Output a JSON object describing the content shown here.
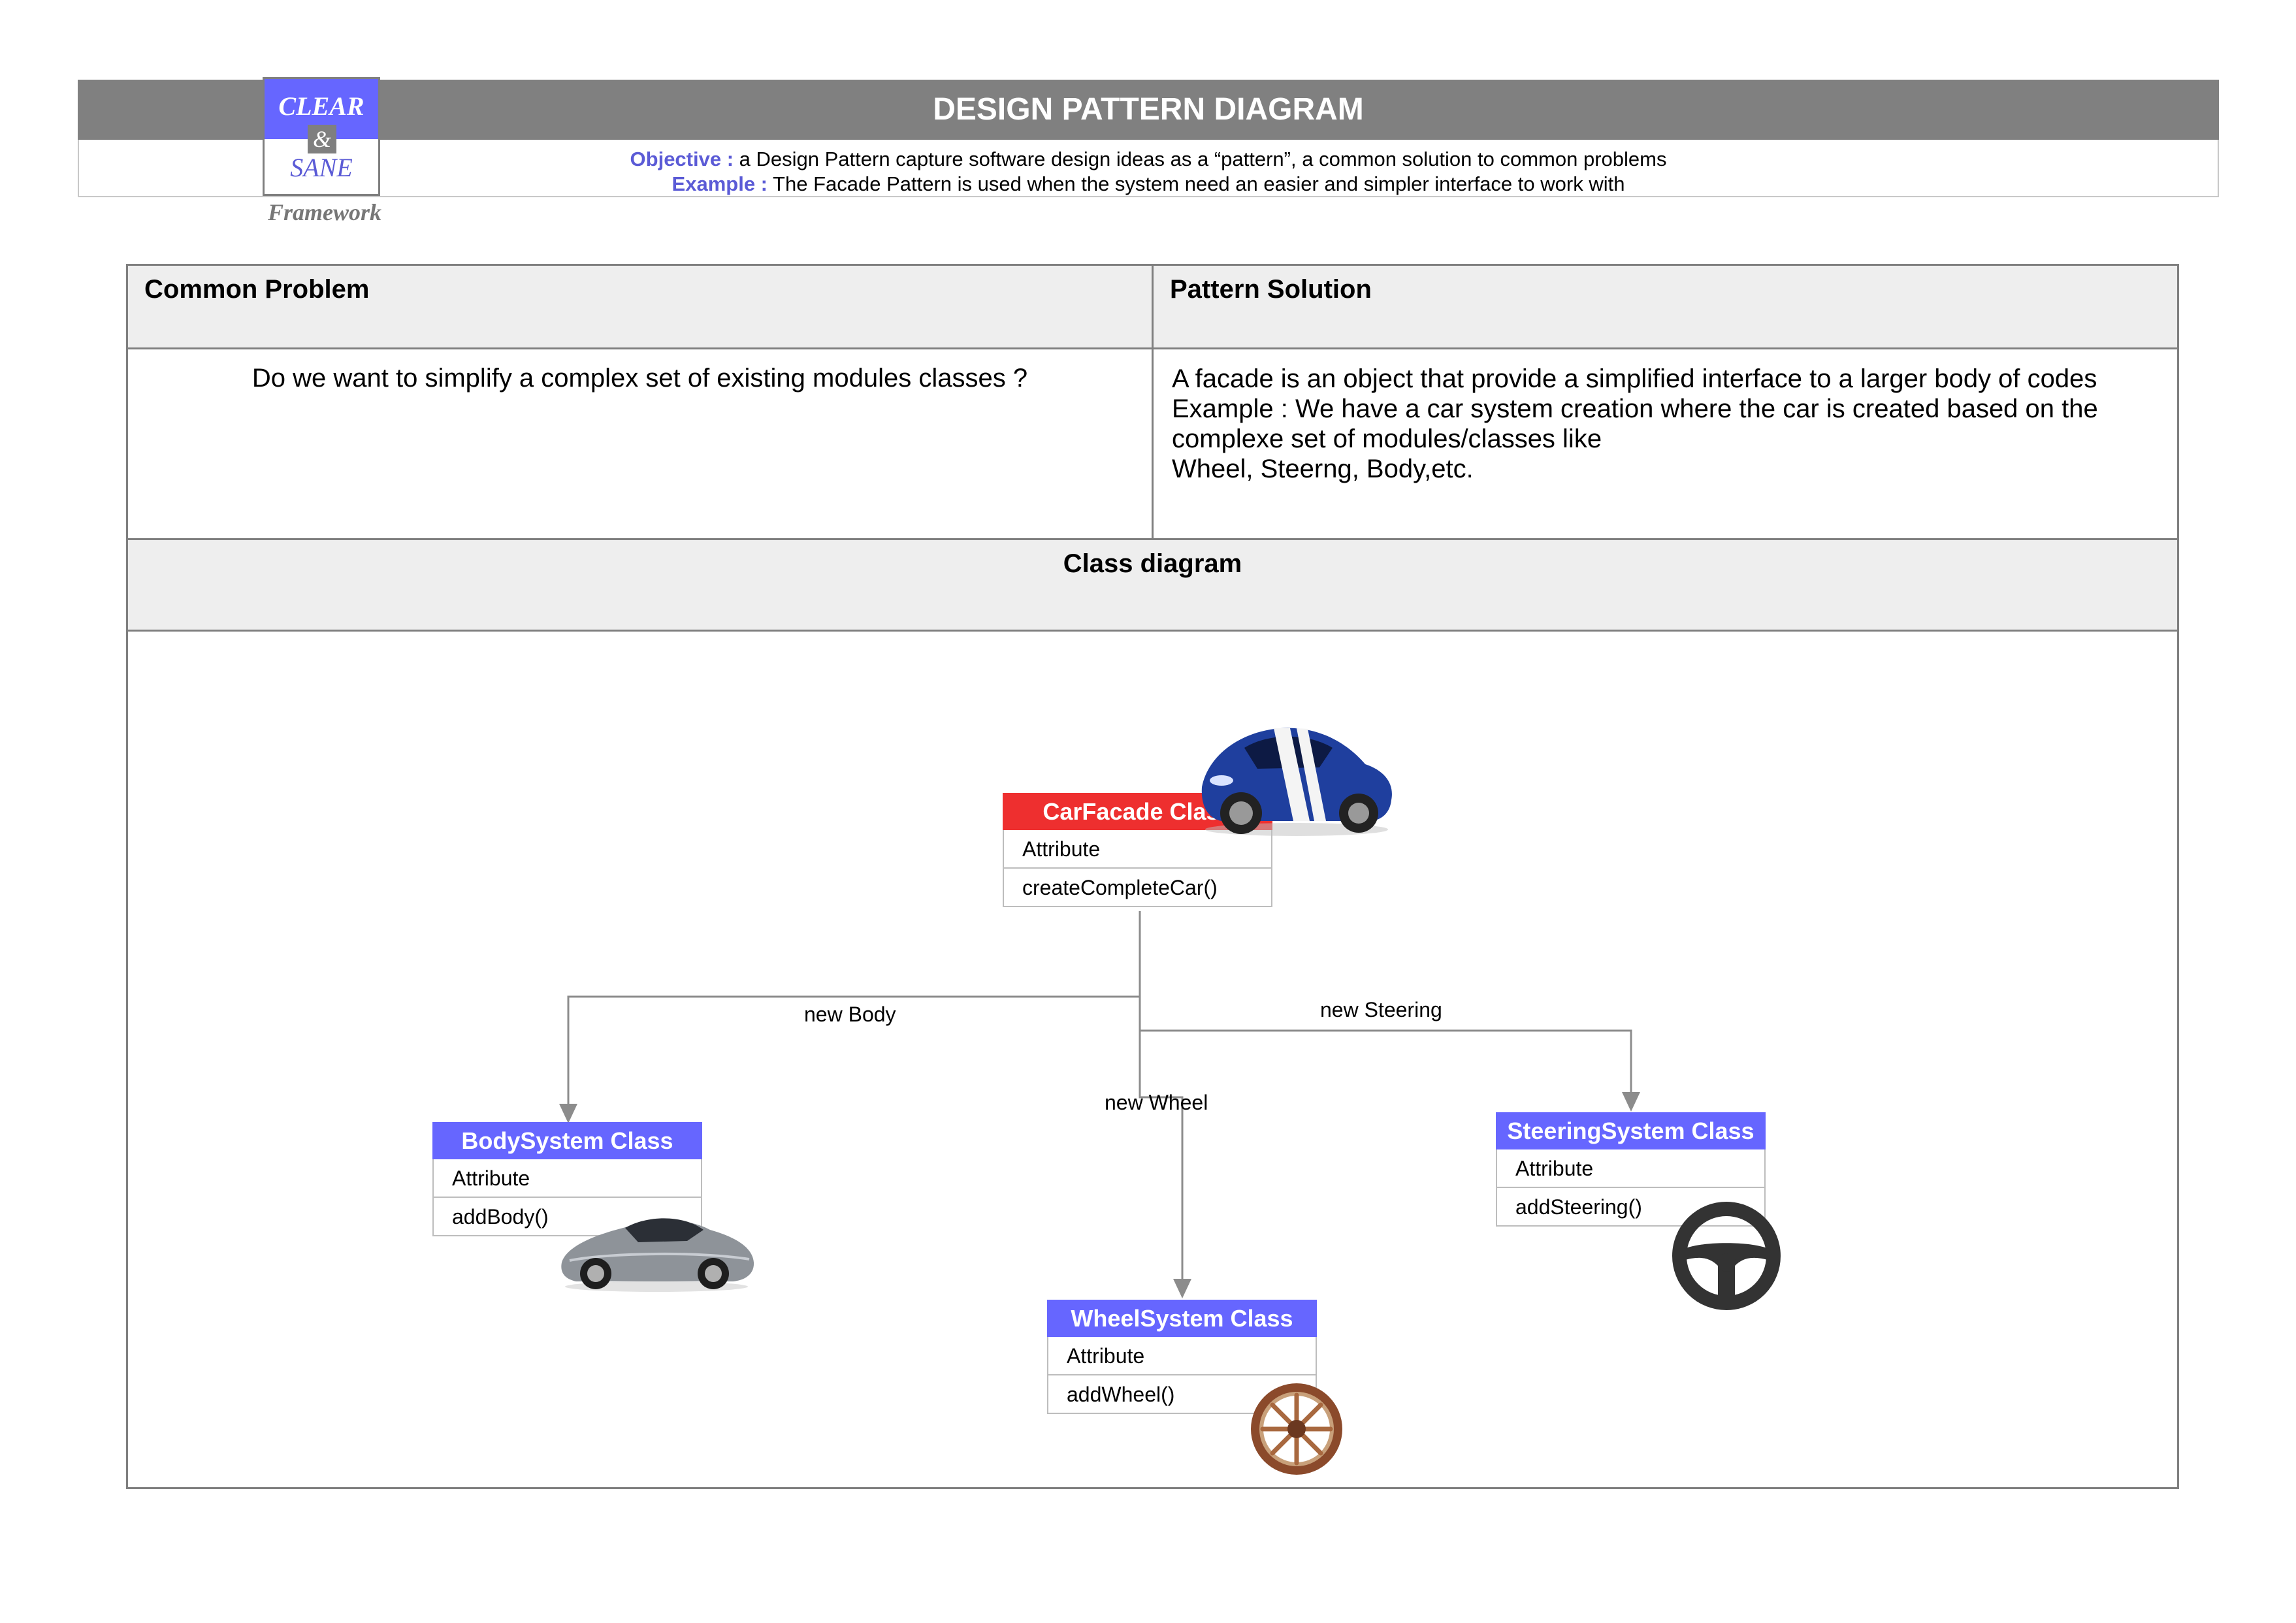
{
  "header": {
    "title": "DESIGN PATTERN DIAGRAM",
    "objective_label": "Objective :",
    "objective_text": " a Design Pattern capture software design ideas as a “pattern”, a common solution to common problems",
    "example_label": "Example  :",
    "example_text": "  The Facade Pattern is used when the system need an easier and simpler interface to work with"
  },
  "logo": {
    "line1": "CLEAR",
    "amp": "&",
    "line2": "SANE",
    "subtitle": "Framework"
  },
  "table": {
    "problem_header": "Common Problem",
    "solution_header": "Pattern Solution",
    "problem_text": "Do we want to simplify a complex set of existing modules classes ?",
    "solution_lines": [
      "A facade is an object that provide a simplified interface to a larger body of codes",
      "Example : We have a car system creation where the car is created based on the",
      "complexe set of modules/classes like",
      "Wheel, Steerng, Body,etc."
    ],
    "class_diagram_header": "Class diagram"
  },
  "diagram": {
    "colors": {
      "facade": "#ee2f2f",
      "subsystem": "#6666ff",
      "line": "#8c8c8c"
    },
    "classes": {
      "facade": {
        "title": "CarFacade Class",
        "attribute": "Attribute",
        "method": "createCompleteCar()",
        "icon": "blue-sports-car-icon"
      },
      "body": {
        "title": "BodySystem Class",
        "attribute": "Attribute",
        "method": "addBody()",
        "icon": "silver-sports-car-icon"
      },
      "wheel": {
        "title": "WheelSystem Class",
        "attribute": "Attribute",
        "method": "addWheel()",
        "icon": "wooden-wheel-icon"
      },
      "steering": {
        "title": "SteeringSystem Class",
        "attribute": "Attribute",
        "method": "addSteering()",
        "icon": "steering-wheel-icon"
      }
    },
    "connectors": {
      "body": "new Body",
      "wheel": "new Wheel",
      "steering": "new Steering"
    }
  }
}
